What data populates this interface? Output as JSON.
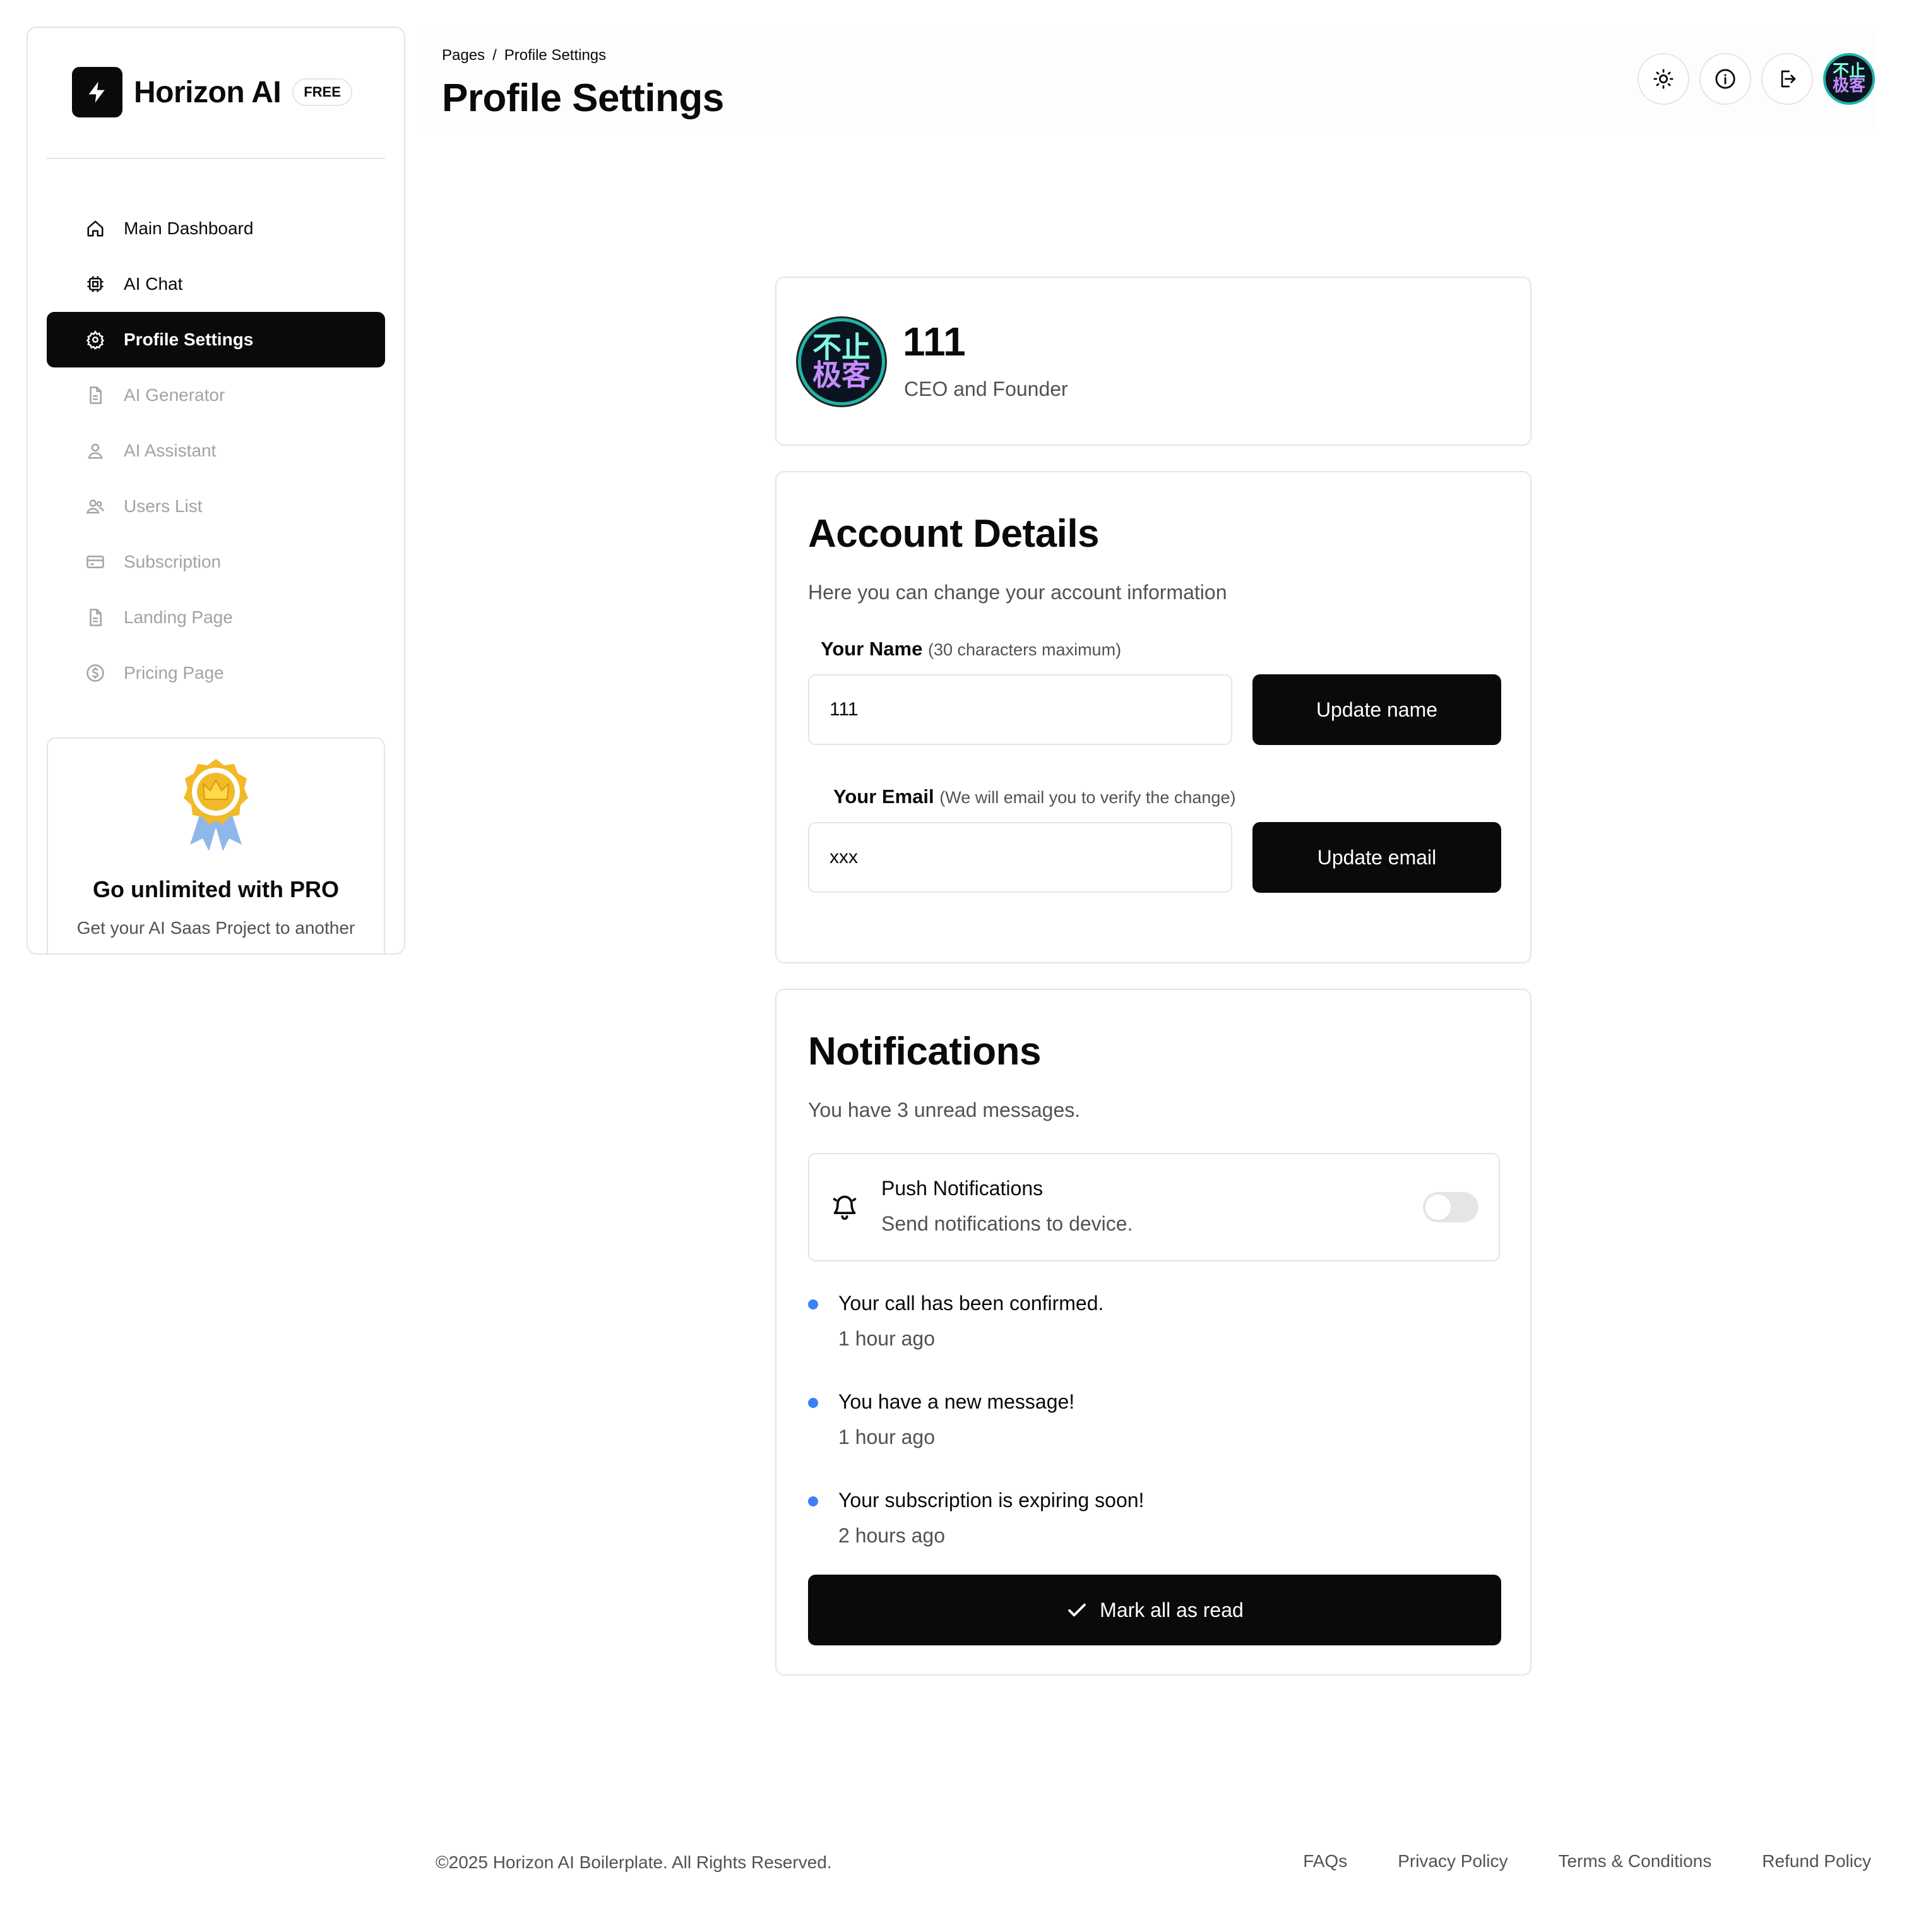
{
  "brand": {
    "name": "Horizon AI",
    "badge": "FREE",
    "logo_icon": "bolt-icon"
  },
  "sidebar": {
    "items": [
      {
        "label": "Main Dashboard",
        "icon": "home-icon",
        "state": "enabled"
      },
      {
        "label": "AI Chat",
        "icon": "chip-icon",
        "state": "enabled"
      },
      {
        "label": "Profile Settings",
        "icon": "gear-icon",
        "state": "active"
      },
      {
        "label": "AI Generator",
        "icon": "document-icon",
        "state": "disabled"
      },
      {
        "label": "AI Assistant",
        "icon": "user-icon",
        "state": "disabled"
      },
      {
        "label": "Users List",
        "icon": "users-icon",
        "state": "disabled"
      },
      {
        "label": "Subscription",
        "icon": "credit-card-icon",
        "state": "disabled"
      },
      {
        "label": "Landing Page",
        "icon": "document-icon",
        "state": "disabled"
      },
      {
        "label": "Pricing Page",
        "icon": "dollar-circle-icon",
        "state": "disabled"
      }
    ],
    "promo": {
      "title": "Go unlimited with PRO",
      "text": "Get your AI Saas Project to another"
    }
  },
  "header": {
    "breadcrumb": {
      "root": "Pages",
      "separator": "/",
      "current": "Profile Settings"
    },
    "title": "Profile Settings",
    "actions": [
      "sun-icon",
      "info-icon",
      "logout-icon",
      "avatar"
    ]
  },
  "avatar": {
    "line1": "不止",
    "line2": "极客"
  },
  "profile": {
    "name": "111",
    "role": "CEO and Founder"
  },
  "account": {
    "title": "Account Details",
    "subtitle": "Here you can change your account information",
    "name_label": "Your Name",
    "name_hint": "(30 characters maximum)",
    "name_value": "111",
    "name_button": "Update name",
    "email_label": "Your Email",
    "email_hint": "(We will email you to verify the change)",
    "email_value": "xxx",
    "email_button": "Update email"
  },
  "notifications": {
    "title": "Notifications",
    "subtitle": "You have 3 unread messages.",
    "push": {
      "title": "Push Notifications",
      "subtitle": "Send notifications to device.",
      "enabled": false
    },
    "items": [
      {
        "title": "Your call has been confirmed.",
        "time": "1 hour ago"
      },
      {
        "title": "You have a new message!",
        "time": "1 hour ago"
      },
      {
        "title": "Your subscription is expiring soon!",
        "time": "2 hours ago"
      }
    ],
    "mark_all_label": "Mark all as read",
    "dot_color": "#3b82f6"
  },
  "footer": {
    "copyright": "©2025 Horizon AI Boilerplate. All Rights Reserved.",
    "links": [
      "FAQs",
      "Privacy Policy",
      "Terms & Conditions",
      "Refund Policy"
    ]
  },
  "colors": {
    "primary": "#0a0a0a",
    "muted_text": "#525252",
    "disabled_text": "#a3a3a3",
    "border": "#e5e5e5"
  }
}
